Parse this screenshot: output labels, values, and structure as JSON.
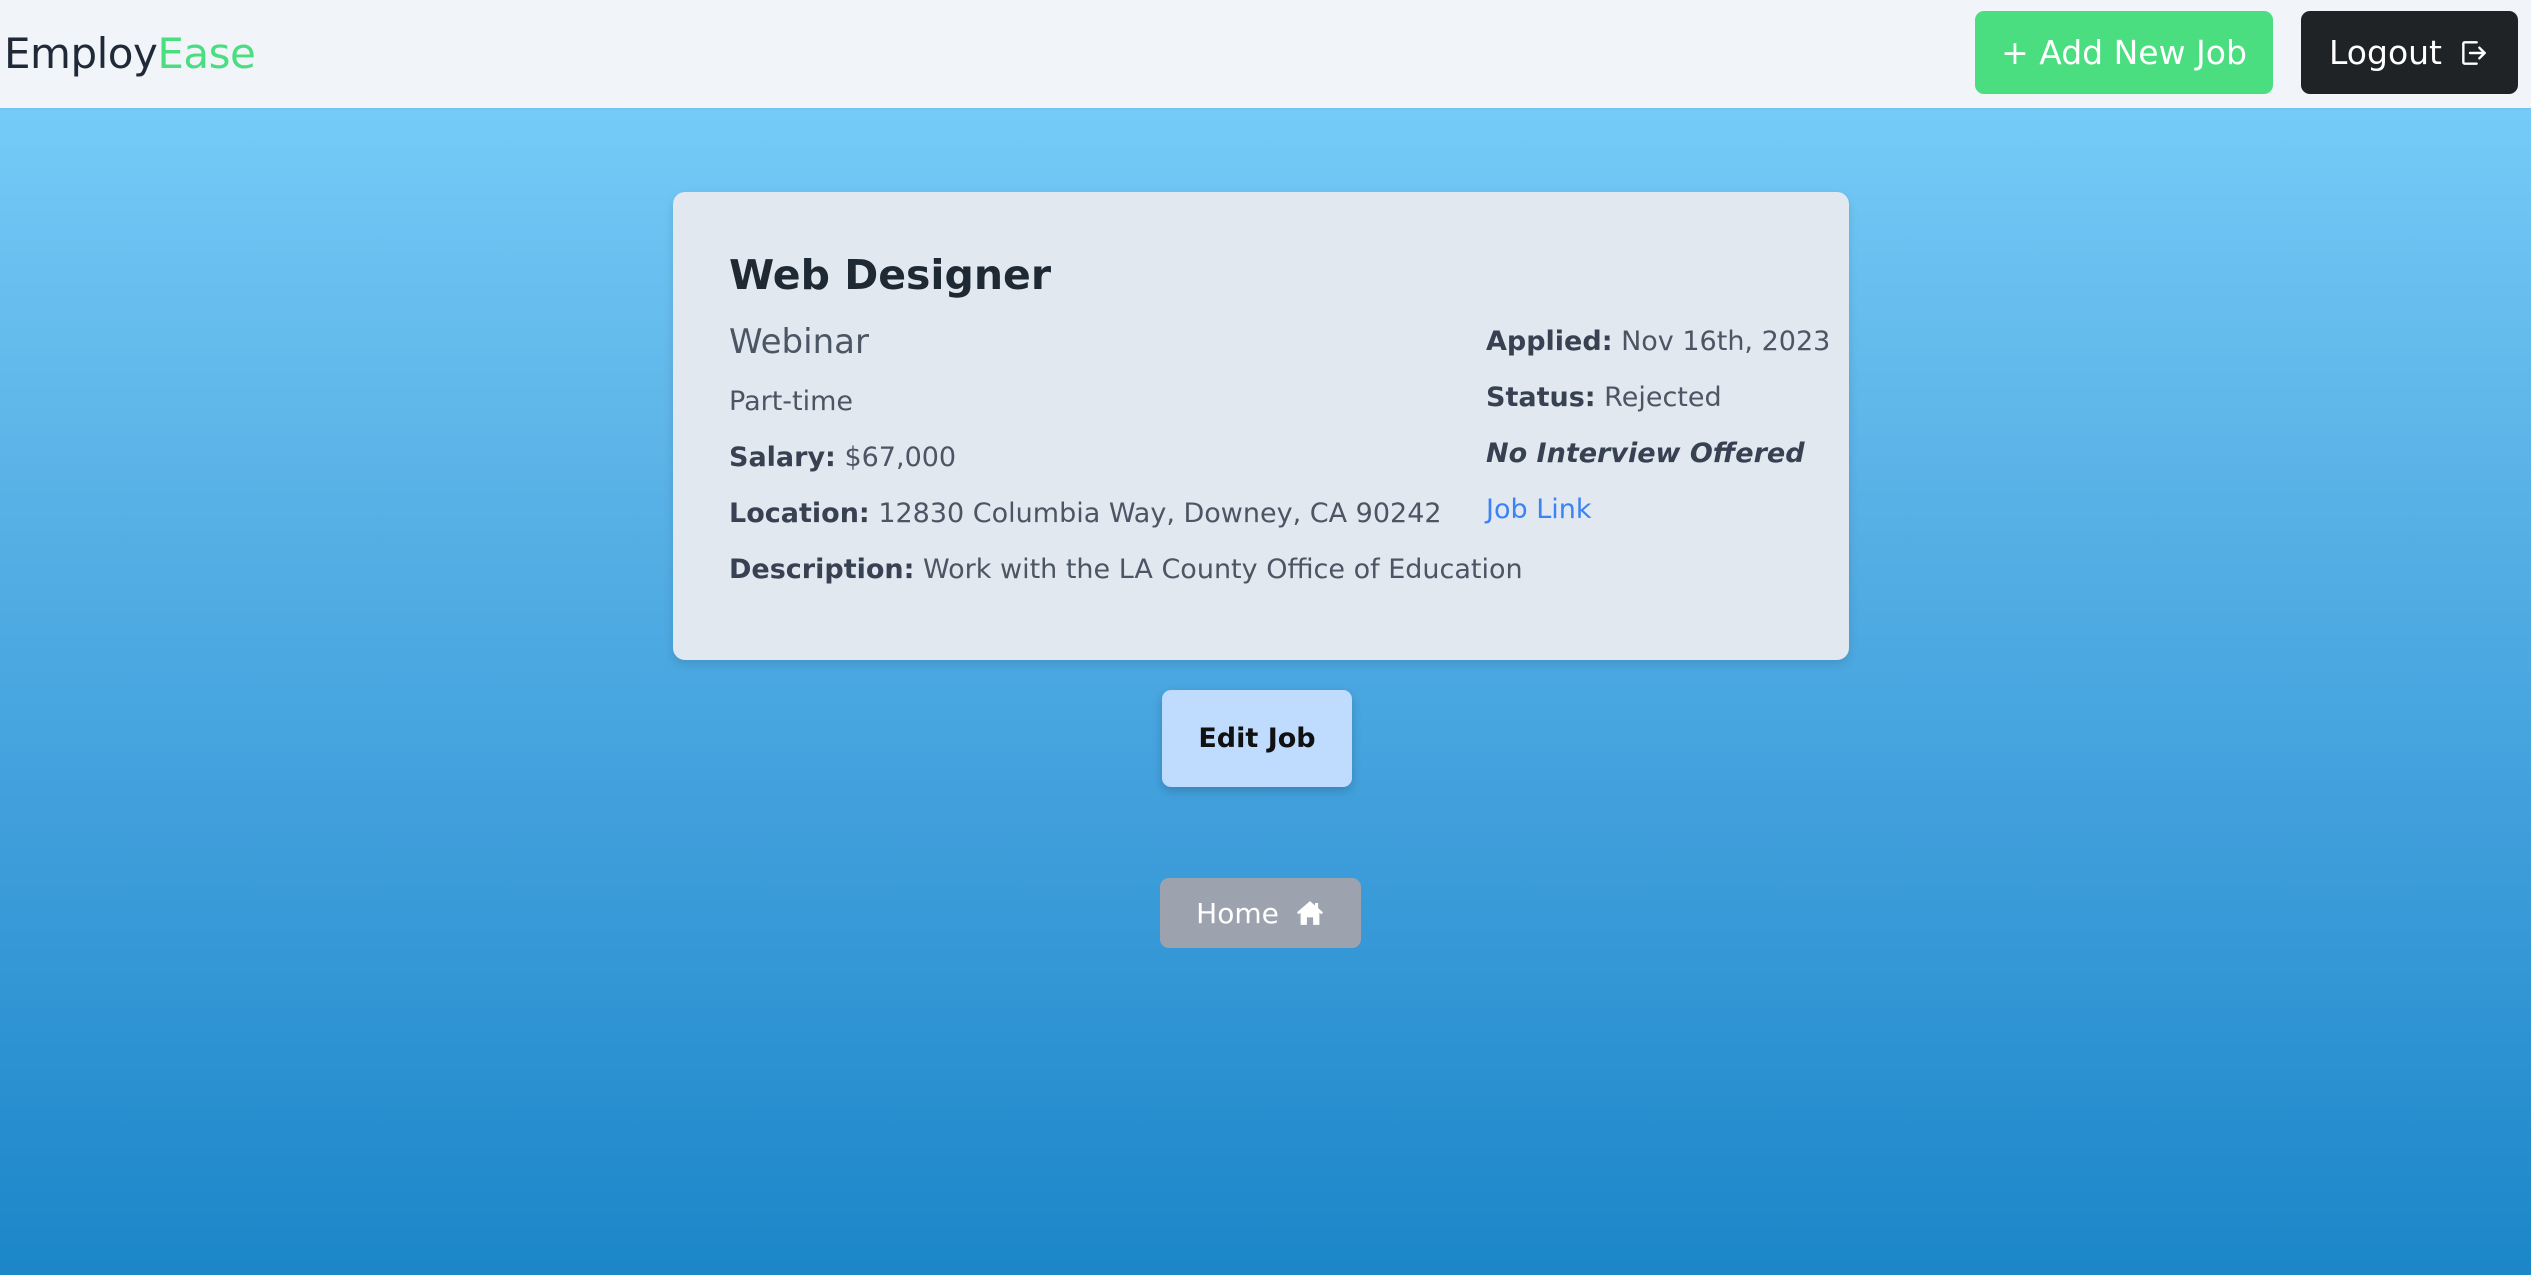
{
  "header": {
    "brand_part1": "Employ",
    "brand_part2": "Ease",
    "add_job_label": "+ Add New Job",
    "logout_label": "Logout",
    "logout_icon": "logout-icon"
  },
  "job": {
    "title": "Web Designer",
    "company": "Webinar",
    "type": "Part-time",
    "salary_label": "Salary:",
    "salary": "$67,000",
    "location_label": "Location:",
    "location": "12830 Columbia Way, Downey, CA 90242",
    "description_label": "Description:",
    "description": "Work with the LA County Office of Education",
    "applied_label": "Applied:",
    "applied": "Nov 16th, 2023",
    "status_label": "Status:",
    "status": "Rejected",
    "interview": "No Interview Offered",
    "link_label": "Job Link"
  },
  "actions": {
    "edit_label": "Edit Job",
    "home_label": "Home",
    "home_icon": "home-icon"
  },
  "colors": {
    "brand_accent": "#4ade80",
    "add_button": "#4ade80",
    "logout_button": "#1f2326",
    "edit_button": "#bfdbfe",
    "home_button": "#9ca3af",
    "link": "#3b82f6"
  }
}
